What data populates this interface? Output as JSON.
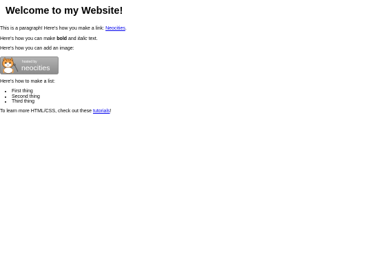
{
  "heading": "Welcome to my Website!",
  "intro": {
    "prefix": "This is a paragraph! Here's how you make a link: ",
    "link_label": "Neocities",
    "suffix": "."
  },
  "format": {
    "prefix": "Here's how you can make ",
    "bold": "bold",
    "middle": " and ",
    "italic": "italic",
    "suffix": " text."
  },
  "image_intro": "Here's how you can add an image:",
  "badge": {
    "small_text": "hosted by",
    "large_text": "neocities",
    "alt": "Site hosted by Neocities"
  },
  "list_intro": "Here's how to make a list:",
  "list_items": [
    "First thing",
    "Second thing",
    "Third thing"
  ],
  "outro": {
    "prefix": "To learn more HTML/CSS, check out these ",
    "link_label": "tutorials",
    "suffix": "!"
  },
  "colors": {
    "link": "#0000ee",
    "badge_bg": "#9a9a9a",
    "cat_orange": "#f2a24a"
  }
}
